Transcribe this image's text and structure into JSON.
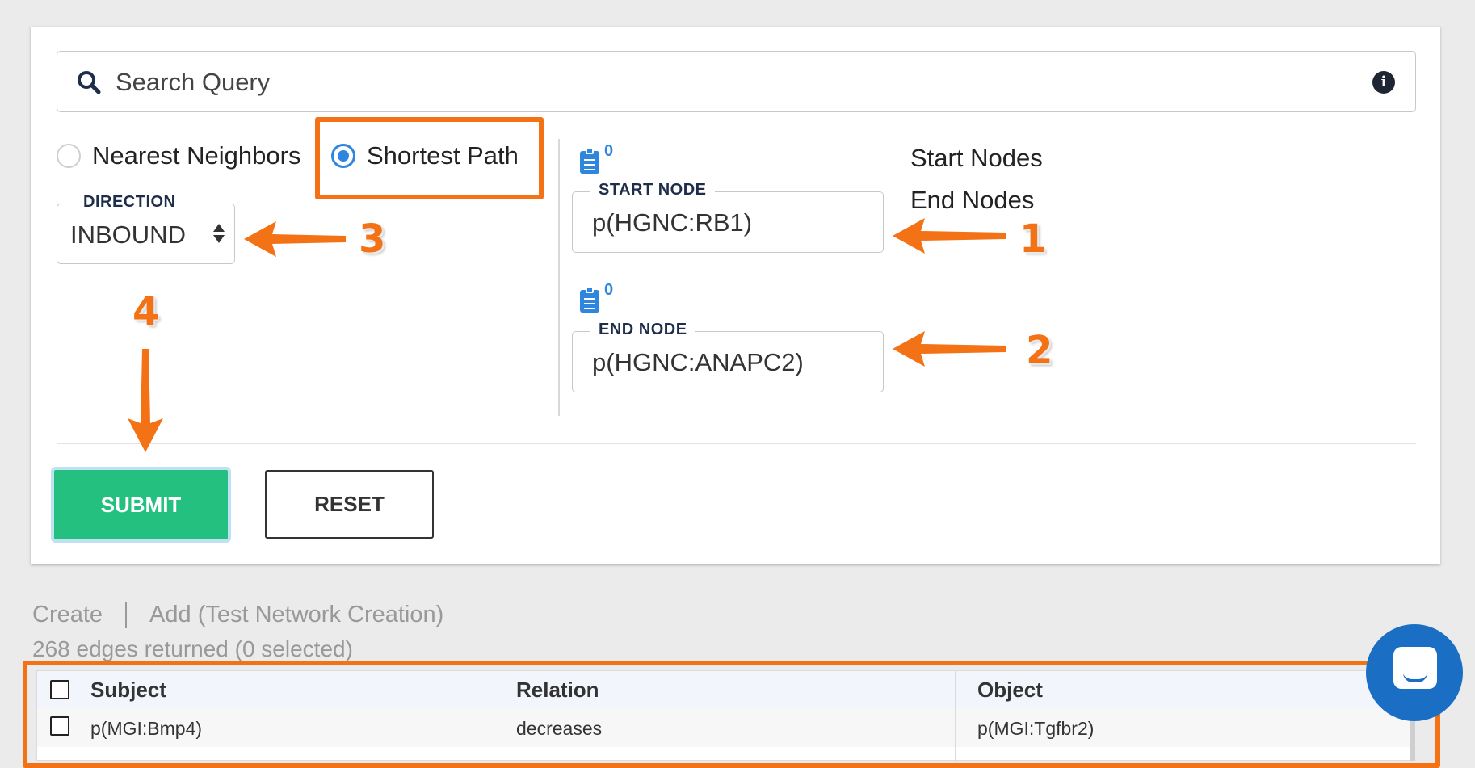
{
  "search": {
    "placeholder": "Search Query",
    "info_icon": "info-icon",
    "search_icon": "search-icon"
  },
  "mode": {
    "options": [
      {
        "label": "Nearest Neighbors",
        "selected": false
      },
      {
        "label": "Shortest Path",
        "selected": true
      }
    ]
  },
  "direction": {
    "legend": "DIRECTION",
    "value": "INBOUND"
  },
  "start_node": {
    "legend": "START NODE",
    "value": "p(HGNC:RB1)",
    "count": "0"
  },
  "end_node": {
    "legend": "END NODE",
    "value": "p(HGNC:ANAPC2)",
    "count": "0"
  },
  "side_labels": {
    "start": "Start Nodes",
    "end": "End Nodes"
  },
  "buttons": {
    "submit": "SUBMIT",
    "reset": "RESET"
  },
  "links": {
    "create": "Create",
    "add": "Add (Test Network Creation)"
  },
  "edges_text": "268 edges returned (0 selected)",
  "table": {
    "headers": [
      "Subject",
      "Relation",
      "Object"
    ],
    "rows": [
      [
        "p(MGI:Bmp4)",
        "decreases",
        "p(MGI:Tgfbr2)"
      ]
    ]
  },
  "annotations": {
    "n1": "1",
    "n2": "2",
    "n3": "3",
    "n4": "4",
    "color": "#f47216"
  },
  "colors": {
    "accent": "#2e86de",
    "submit": "#23c07f",
    "annotation": "#f47216",
    "chat": "#1a6ec4"
  }
}
